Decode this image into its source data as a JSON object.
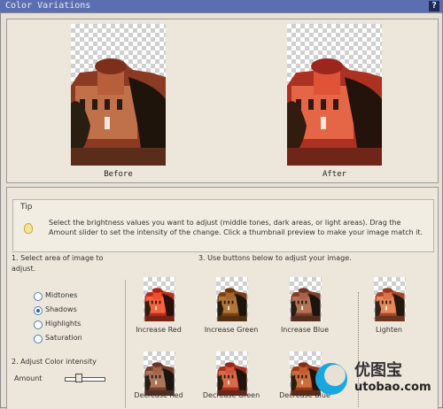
{
  "window": {
    "title": "Color Variations",
    "help_label": "?"
  },
  "preview": {
    "before_label": "Before",
    "after_label": "After"
  },
  "tip": {
    "label": "Tip",
    "text": "Select the brightness values you want to adjust (middle tones, dark areas, or light areas). Drag the Amount slider to set the intensity of the change. Click a thumbnail preview to make your image match it."
  },
  "steps": {
    "step1": "1. Select area of image to adjust.",
    "step2": "2. Adjust Color intensity",
    "step3": "3. Use buttons below to adjust your image."
  },
  "areas": [
    {
      "label": "Midtones",
      "selected": false
    },
    {
      "label": "Shadows",
      "selected": true
    },
    {
      "label": "Highlights",
      "selected": false
    },
    {
      "label": "Saturation",
      "selected": false
    }
  ],
  "amount": {
    "label": "Amount",
    "value": 0.3
  },
  "buttons": {
    "increase_red": "Increase Red",
    "increase_green": "Increase Green",
    "increase_blue": "Increase Blue",
    "lighten": "Lighten",
    "decrease_red": "Decrease Red",
    "decrease_green": "Decrease Green",
    "decrease_blue": "Decrease Blue"
  },
  "watermark": {
    "cn": "优图宝",
    "url": "utobao.com"
  }
}
